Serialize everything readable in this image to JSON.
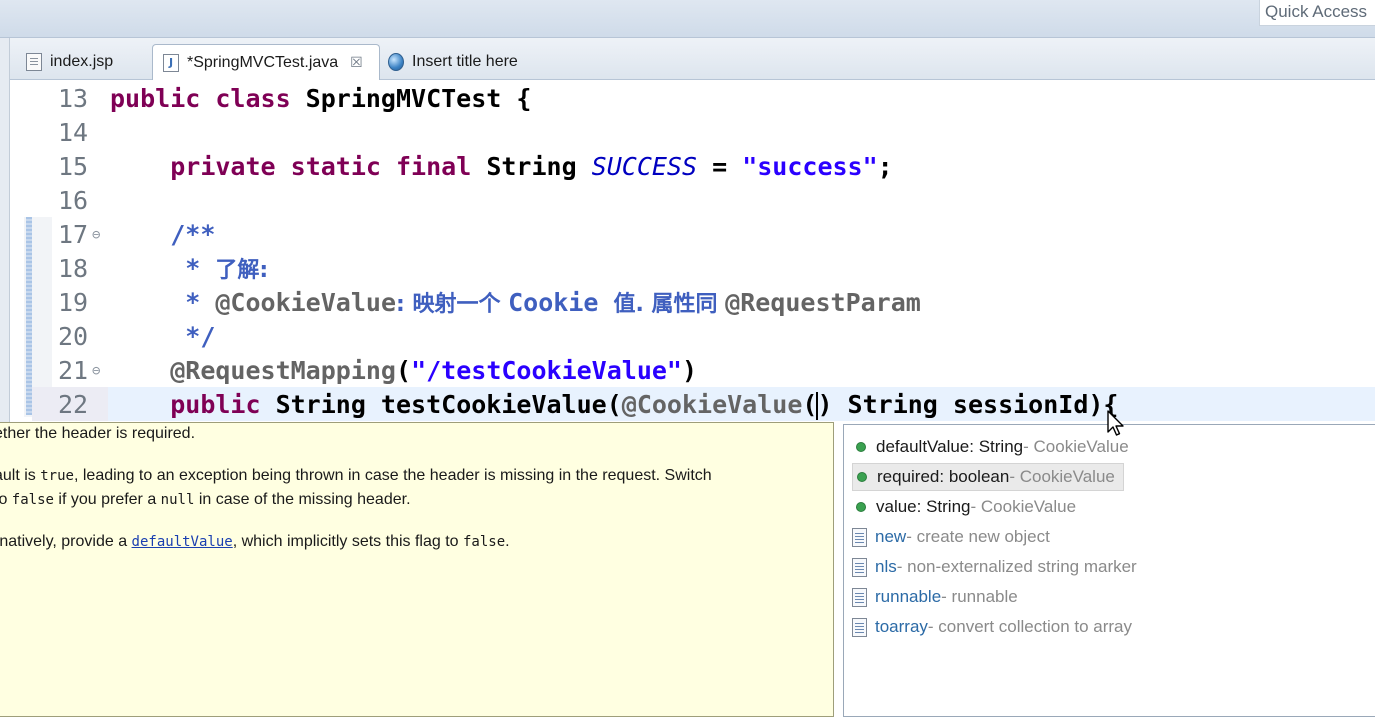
{
  "quick_access": "Quick Access",
  "tabs": [
    {
      "label": "index.jsp",
      "icon": "jsp-file-icon"
    },
    {
      "label": "*SpringMVCTest.java",
      "icon": "java-file-icon",
      "close": "☒"
    },
    {
      "label": "Insert title here",
      "icon": "globe-icon"
    }
  ],
  "code_lines": [
    {
      "n": "13",
      "tokens": [
        [
          "kw",
          "public "
        ],
        [
          "kw",
          "class "
        ],
        [
          "plain",
          "SpringMVCTest {"
        ]
      ]
    },
    {
      "n": "14",
      "tokens": []
    },
    {
      "n": "15",
      "tokens": [
        [
          "plain",
          "    "
        ],
        [
          "kw",
          "private "
        ],
        [
          "kw",
          "static "
        ],
        [
          "kw",
          "final "
        ],
        [
          "plain",
          "String "
        ],
        [
          "const",
          "SUCCESS"
        ],
        [
          "plain",
          " = "
        ],
        [
          "str",
          "\"success\""
        ],
        [
          "plain",
          ";"
        ]
      ]
    },
    {
      "n": "16",
      "tokens": []
    },
    {
      "n": "17",
      "fold": "⊖",
      "tokens": [
        [
          "plain",
          "    "
        ],
        [
          "doc",
          "/**"
        ]
      ]
    },
    {
      "n": "18",
      "tokens": [
        [
          "plain",
          "     "
        ],
        [
          "doc",
          "* "
        ],
        [
          "doc cjk",
          "了解:"
        ]
      ]
    },
    {
      "n": "19",
      "tokens": [
        [
          "plain",
          "     "
        ],
        [
          "doc",
          "* "
        ],
        [
          "ann",
          "@CookieValue"
        ],
        [
          "doc cjk",
          ": 映射一个 "
        ],
        [
          "doc",
          "Cookie "
        ],
        [
          "doc cjk",
          "值. 属性同 "
        ],
        [
          "ann",
          "@RequestParam"
        ]
      ]
    },
    {
      "n": "20",
      "tokens": [
        [
          "plain",
          "     "
        ],
        [
          "doc",
          "*/"
        ]
      ]
    },
    {
      "n": "21",
      "fold": "⊖",
      "tokens": [
        [
          "plain",
          "    "
        ],
        [
          "ann",
          "@RequestMapping"
        ],
        [
          "plain",
          "("
        ],
        [
          "str",
          "\"/testCookieValue\""
        ],
        [
          "plain",
          ")"
        ]
      ]
    },
    {
      "n": "22",
      "tokens": [
        [
          "plain",
          "    "
        ],
        [
          "kw",
          "public "
        ],
        [
          "plain",
          "String testCookieValue("
        ],
        [
          "ann",
          "@CookieValue"
        ],
        [
          "plain",
          "("
        ],
        [
          "caret",
          ""
        ],
        [
          "plain",
          ") String sessionId){"
        ]
      ]
    }
  ],
  "doc_popup": {
    "line1": "ether the header is required.",
    "line2a": "ault is ",
    "line2b": "true",
    "line2c": ", leading to an exception being thrown in case the header is missing in the request. Switch",
    "line3a": "to ",
    "line3b": "false",
    "line3c": " if you prefer a ",
    "line3d": "null",
    "line3e": " in case of the missing header.",
    "line4a": "rnatively, provide a ",
    "line4b": "defaultValue",
    "line4c": ", which implicitly sets this flag to ",
    "line4d": "false",
    "line4e": "."
  },
  "assist": [
    {
      "kind": "field",
      "name": "defaultValue",
      "type": " : String",
      "owner": " - CookieValue"
    },
    {
      "kind": "field",
      "name": "required",
      "type": " : boolean",
      "owner": " - CookieValue",
      "selected": true
    },
    {
      "kind": "field",
      "name": "value",
      "type": " : String",
      "owner": " - CookieValue"
    },
    {
      "kind": "template",
      "name": "new",
      "desc": " - create new object"
    },
    {
      "kind": "template",
      "name": "nls",
      "desc": " - non-externalized string marker"
    },
    {
      "kind": "template",
      "name": "runnable",
      "desc": " - runnable"
    },
    {
      "kind": "template",
      "name": "toarray",
      "desc": " - convert collection to array"
    }
  ]
}
